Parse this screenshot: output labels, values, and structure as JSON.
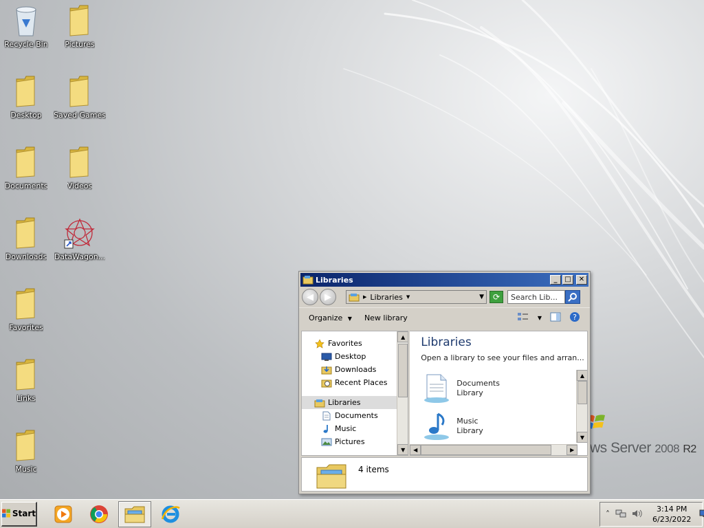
{
  "desktop": {
    "icons": [
      {
        "label": "Recycle Bin",
        "icon": "recycle-bin-icon"
      },
      {
        "label": "Pictures",
        "icon": "folder-icon"
      },
      {
        "label": "Desktop",
        "icon": "folder-icon"
      },
      {
        "label": "Saved Games",
        "icon": "folder-icon"
      },
      {
        "label": "Documents",
        "icon": "folder-icon"
      },
      {
        "label": "Videos",
        "icon": "folder-icon"
      },
      {
        "label": "Downloads",
        "icon": "folder-icon"
      },
      {
        "label": "DataWagon...",
        "icon": "datawagon-shortcut-icon"
      },
      {
        "label": "Favorites",
        "icon": "folder-icon"
      },
      {
        "label": "Links",
        "icon": "folder-icon"
      },
      {
        "label": "Music",
        "icon": "folder-icon"
      }
    ],
    "branding": {
      "text": "ws Server",
      "version": "2008",
      "edition": "R2"
    }
  },
  "window": {
    "title": "Libraries",
    "address": {
      "segment": "Libraries"
    },
    "search": {
      "placeholder": "Search Lib..."
    },
    "toolbar": {
      "organize": "Organize",
      "new_library": "New library"
    },
    "navpane": {
      "items": [
        {
          "label": "Favorites",
          "icon": "star-icon",
          "level": 0
        },
        {
          "label": "Desktop",
          "icon": "desktop-icon",
          "level": 1
        },
        {
          "label": "Downloads",
          "icon": "downloads-icon",
          "level": 1
        },
        {
          "label": "Recent Places",
          "icon": "recent-places-icon",
          "level": 1
        },
        {
          "label": "Libraries",
          "icon": "libraries-icon",
          "level": 0,
          "selected": true
        },
        {
          "label": "Documents",
          "icon": "documents-icon",
          "level": 1
        },
        {
          "label": "Music",
          "icon": "music-icon",
          "level": 1
        },
        {
          "label": "Pictures",
          "icon": "pictures-icon",
          "level": 1
        }
      ]
    },
    "main": {
      "title": "Libraries",
      "subtitle": "Open a library to see your files and arran...",
      "libraries": [
        {
          "name": "Documents",
          "type": "Library",
          "icon": "documents-library-icon"
        },
        {
          "name": "Music",
          "type": "Library",
          "icon": "music-library-icon"
        }
      ]
    },
    "details": {
      "count_text": "4 items"
    }
  },
  "taskbar": {
    "start_label": "Start",
    "apps": [
      {
        "name": "media-player-icon"
      },
      {
        "name": "chrome-icon"
      },
      {
        "name": "file-explorer-icon",
        "active": true
      },
      {
        "name": "internet-explorer-icon"
      }
    ],
    "clock": {
      "time": "3:14 PM",
      "date": "6/23/2022"
    }
  }
}
